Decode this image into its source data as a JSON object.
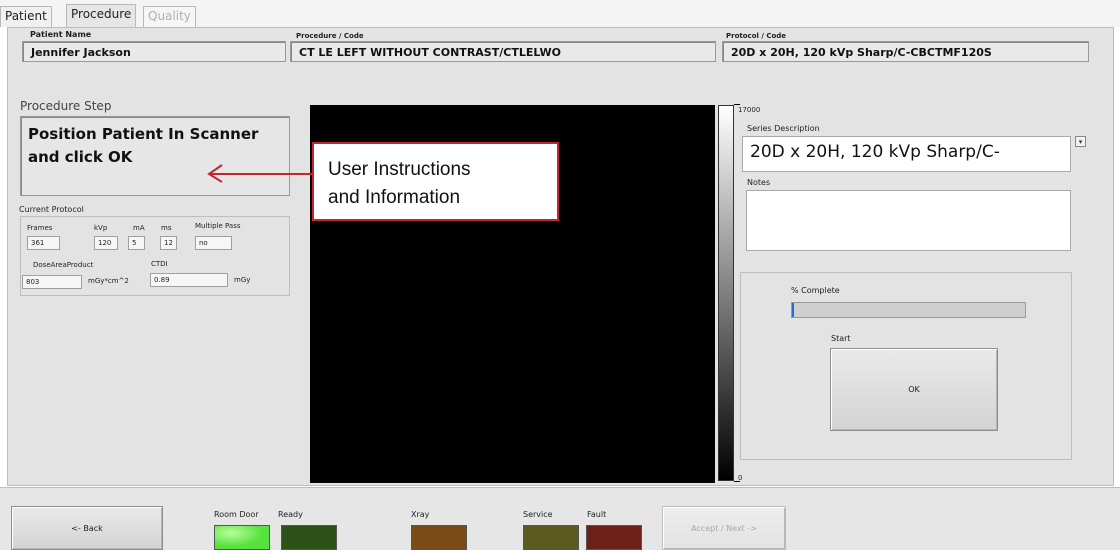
{
  "tabs": [
    {
      "label": "Patient"
    },
    {
      "label": "Procedure"
    },
    {
      "label": "Quality"
    }
  ],
  "header": {
    "patient_name_label": "Patient Name",
    "patient_name_value": "Jennifer Jackson",
    "procedure_label": "Procedure / Code",
    "procedure_value": "CT LE LEFT WITHOUT CONTRAST/CTLELWO",
    "protocol_label": "Protocol / Code",
    "protocol_value": "20D x 20H, 120 kVp Sharp/C-CBCTMF120S"
  },
  "procedure_step": {
    "label": "Procedure Step",
    "line1": "Position Patient In Scanner",
    "line2": "and click OK"
  },
  "annotation": {
    "line1": "User Instructions",
    "line2": "and Information"
  },
  "current_protocol": {
    "label": "Current Protocol",
    "frames_label": "Frames",
    "frames_value": "361",
    "kvp_label": "kVp",
    "kvp_value": "120",
    "ma_label": "mA",
    "ma_value": "5",
    "ms_label": "ms",
    "ms_value": "12",
    "multipass_label": "Multiple Pass",
    "multipass_value": "no",
    "dap_label": "DoseAreaProduct",
    "dap_value": "803",
    "dap_unit": "mGy*cm^2",
    "ctdi_label": "CTDI",
    "ctdi_value": "0.89",
    "ctdi_unit": "mGy"
  },
  "colorbar": {
    "max": "17000",
    "min": "0"
  },
  "series": {
    "label": "Series Description",
    "value": "20D x 20H, 120 kVp Sharp/C-",
    "notes_label": "Notes",
    "notes_value": ""
  },
  "progress": {
    "label": "% Complete",
    "percent": 1,
    "start_label": "Start",
    "ok_label": "OK"
  },
  "statusbar": {
    "back_label": "<- Back",
    "room_door_label": "Room Door",
    "ready_label": "Ready",
    "xray_label": "Xray",
    "service_label": "Service",
    "fault_label": "Fault",
    "accept_label": "Accept / Next ->"
  },
  "colors": {
    "room_door": "#55e23a",
    "ready": "#2c5218",
    "xray": "#7a4a17",
    "service": "#5c5a1e",
    "fault": "#6e1f18",
    "annotation_border": "#c0282d"
  }
}
